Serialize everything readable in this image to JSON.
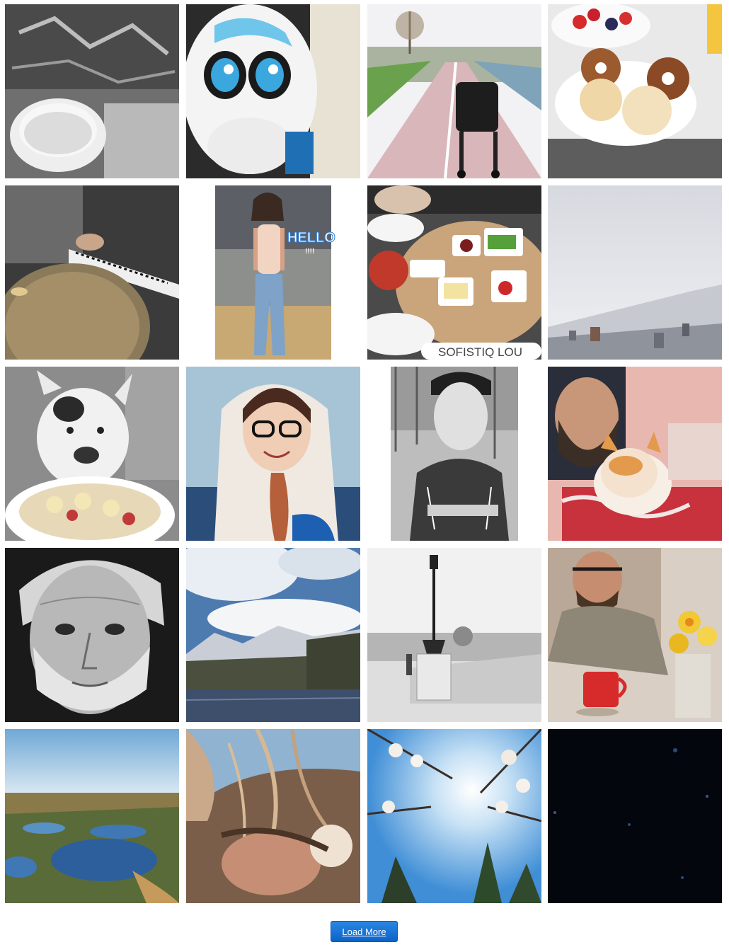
{
  "gallery": {
    "photos": [
      {
        "subject": "coffee cup on graphic sweater"
      },
      {
        "subject": "unicorn hood costume"
      },
      {
        "subject": "stroller on bike path"
      },
      {
        "subject": "donuts and berries breakfast"
      },
      {
        "subject": "cymbal and keyboard"
      },
      {
        "subject": "woman with sunglasses, HELLO sticker",
        "overlay_text": "HELLO",
        "overlay_sub": "!!!!"
      },
      {
        "subject": "breakfast platter",
        "overlay_text": "SOFISTIQ LOU"
      },
      {
        "subject": "foggy mountain town"
      },
      {
        "subject": "bulldog and oatmeal bowl"
      },
      {
        "subject": "girl in hoodie with glasses"
      },
      {
        "subject": "young man in cap, park"
      },
      {
        "subject": "man with cat"
      },
      {
        "subject": "old man portrait"
      },
      {
        "subject": "mountains and lake"
      },
      {
        "subject": "lamp post on bridge"
      },
      {
        "subject": "man with red mug and daffodils"
      },
      {
        "subject": "aerial lake landscape"
      },
      {
        "subject": "windblown hair"
      },
      {
        "subject": "blossom branches against sun"
      },
      {
        "subject": "dark starry sky"
      }
    ]
  },
  "actions": {
    "load_more_label": "Load More"
  }
}
